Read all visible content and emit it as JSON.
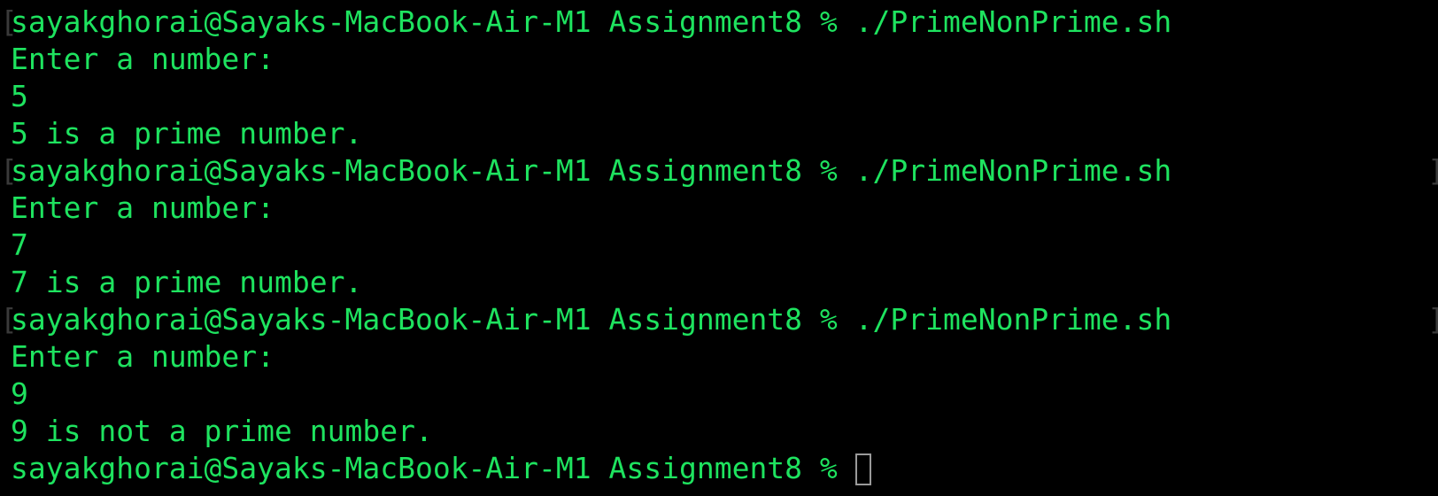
{
  "terminal": {
    "colors": {
      "background": "#000000",
      "text": "#1ee35f",
      "cursor": "#9a9a9a"
    },
    "lines": [
      {
        "text": "sayakghorai@Sayaks-MacBook-Air-M1 Assignment8 % ./PrimeNonPrime.sh",
        "kind": "command"
      },
      {
        "text": "Enter a number:",
        "kind": "output"
      },
      {
        "text": "5",
        "kind": "input"
      },
      {
        "text": "5 is a prime number.",
        "kind": "output"
      },
      {
        "text": "sayakghorai@Sayaks-MacBook-Air-M1 Assignment8 % ./PrimeNonPrime.sh",
        "kind": "command"
      },
      {
        "text": "Enter a number:",
        "kind": "output"
      },
      {
        "text": "7",
        "kind": "input"
      },
      {
        "text": "7 is a prime number.",
        "kind": "output"
      },
      {
        "text": "sayakghorai@Sayaks-MacBook-Air-M1 Assignment8 % ./PrimeNonPrime.sh",
        "kind": "command"
      },
      {
        "text": "Enter a number:",
        "kind": "output"
      },
      {
        "text": "9",
        "kind": "input"
      },
      {
        "text": "9 is not a prime number.",
        "kind": "output"
      }
    ],
    "prompt": "sayakghorai@Sayaks-MacBook-Air-M1 Assignment8 % "
  }
}
